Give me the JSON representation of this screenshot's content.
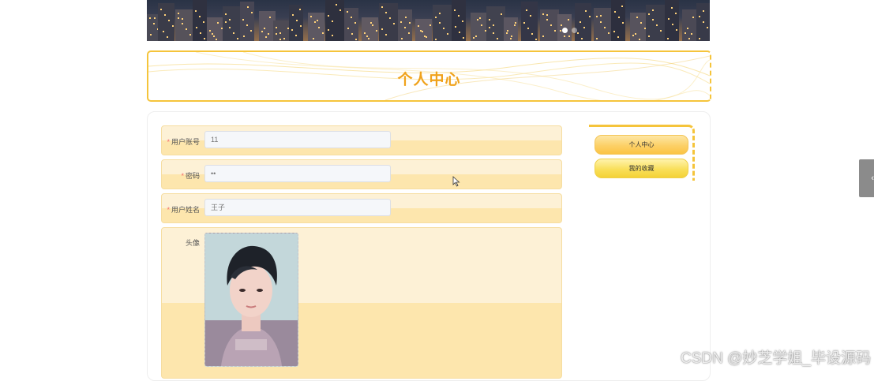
{
  "banner": {
    "carousel_dots": 2,
    "active_dot": 1
  },
  "page": {
    "title": "个人中心"
  },
  "form": {
    "account": {
      "label": "用户账号",
      "required": true,
      "value": "11"
    },
    "password": {
      "label": "密码",
      "required": true,
      "value": "••"
    },
    "name": {
      "label": "用户姓名",
      "required": true,
      "value": "王子"
    },
    "avatar": {
      "label": "头像"
    }
  },
  "side_menu": {
    "items": [
      {
        "label": "个人中心"
      },
      {
        "label": "我的收藏"
      }
    ]
  },
  "float_tab": {
    "glyph": "‹"
  },
  "watermark": "CSDN @妙芝学姐_毕设源码",
  "colors": {
    "accent": "#f5c43b",
    "title": "#f0a21b",
    "required": "#f56c6c"
  }
}
